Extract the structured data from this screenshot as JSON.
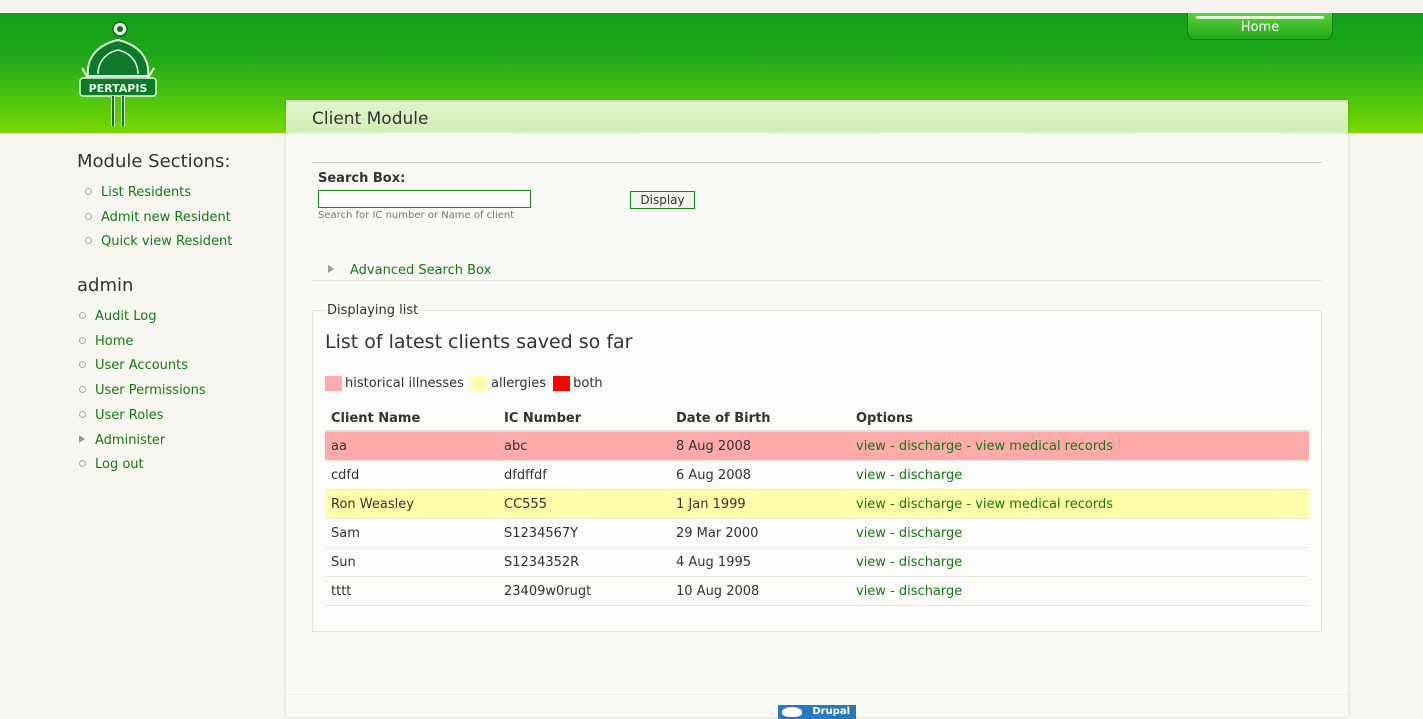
{
  "header": {
    "home_tab": "Home",
    "logo_text": "PERTAPIS",
    "colors": {
      "primary_green": "#1ea61b",
      "light_green": "#78d800",
      "link_green": "#137a13"
    }
  },
  "sidebar": {
    "module_title": "Module Sections:",
    "module_items": [
      {
        "label": "List Residents"
      },
      {
        "label": "Admit new Resident"
      },
      {
        "label": "Quick view Resident"
      }
    ],
    "admin_title": "admin",
    "admin_items": [
      {
        "label": "Audit Log",
        "icon": "circle-bullet-icon"
      },
      {
        "label": "Home",
        "icon": "circle-bullet-icon"
      },
      {
        "label": "User Accounts",
        "icon": "circle-bullet-icon"
      },
      {
        "label": "User Permissions",
        "icon": "circle-bullet-icon"
      },
      {
        "label": "User Roles",
        "icon": "circle-bullet-icon"
      },
      {
        "label": "Administer",
        "icon": "collapsed-triangle-icon"
      },
      {
        "label": "Log out",
        "icon": "circle-bullet-icon"
      }
    ]
  },
  "main": {
    "title": "Client Module",
    "search": {
      "label": "Search Box:",
      "value": "",
      "hint": "Search for IC number or Name of client",
      "button": "Display"
    },
    "advanced_search": "Advanced Search Box",
    "fieldset_legend": "Displaying list",
    "list_title": "List of latest clients saved so far",
    "legend": [
      {
        "label": "historical illnesses",
        "color": "#ffaaaa"
      },
      {
        "label": "allergies",
        "color": "#ffffaa"
      },
      {
        "label": "both",
        "color": "#ff0000"
      }
    ],
    "table": {
      "columns": [
        "Client Name",
        "IC Number",
        "Date of Birth",
        "Options"
      ],
      "option_labels": {
        "view": "view",
        "discharge": "discharge",
        "medical": "view medical records",
        "sep": " - "
      },
      "rows": [
        {
          "name": "aa",
          "ic": "abc",
          "dob": "8 Aug 2008",
          "medical": true,
          "highlight": "#ffaaaa"
        },
        {
          "name": "cdfd",
          "ic": "dfdffdf",
          "dob": "6 Aug 2008",
          "medical": false,
          "highlight": ""
        },
        {
          "name": "Ron Weasley",
          "ic": "CC555",
          "dob": "1 Jan 1999",
          "medical": true,
          "highlight": "#ffffaa"
        },
        {
          "name": "Sam",
          "ic": "S1234567Y",
          "dob": "29 Mar 2000",
          "medical": false,
          "highlight": ""
        },
        {
          "name": "Sun",
          "ic": "S1234352R",
          "dob": "4 Aug 1995",
          "medical": false,
          "highlight": ""
        },
        {
          "name": "tttt",
          "ic": "23409w0rugt",
          "dob": "10 Aug 2008",
          "medical": false,
          "highlight": ""
        }
      ]
    }
  },
  "footer": {
    "badge": "Drupal"
  }
}
